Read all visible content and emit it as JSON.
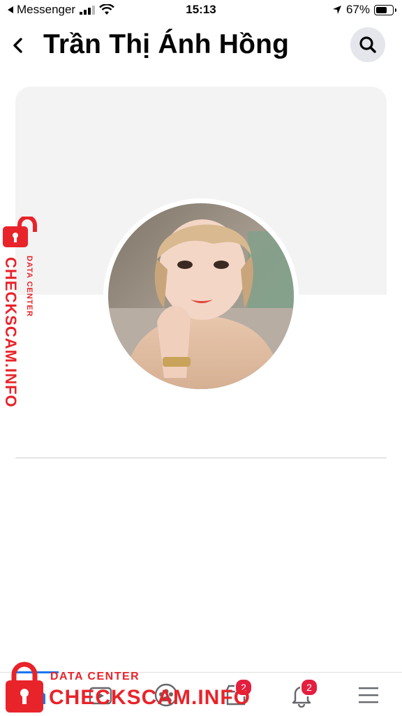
{
  "status_bar": {
    "back_app": "Messenger",
    "time": "15:13",
    "battery": "67%",
    "battery_level": 0.67
  },
  "header": {
    "title": "Trần Thị Ánh Hồng"
  },
  "watermark": {
    "brand": "CHECKSCAM.INFO",
    "sub": "DATA CENTER"
  },
  "nav": {
    "items": [
      {
        "name": "home",
        "badge": ""
      },
      {
        "name": "watch",
        "badge": ""
      },
      {
        "name": "groups",
        "badge": ""
      },
      {
        "name": "marketplace",
        "badge": "2"
      },
      {
        "name": "notifications",
        "badge": "2"
      },
      {
        "name": "menu",
        "badge": ""
      }
    ]
  },
  "colors": {
    "accent": "#1877f2",
    "badge": "#e41e3f",
    "watermark": "#e8232a"
  }
}
